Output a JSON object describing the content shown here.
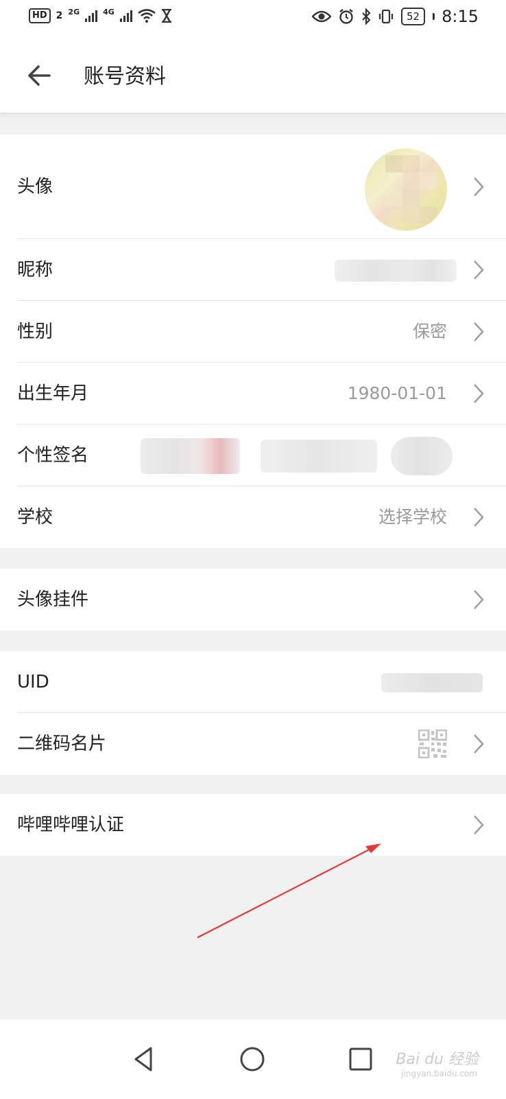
{
  "status_bar": {
    "hd_label": "HD",
    "sim_number": "2",
    "network_1": "2G",
    "network_2": "4G",
    "battery": "52",
    "time": "8:15"
  },
  "header": {
    "title": "账号资料"
  },
  "profile": {
    "avatar_label": "头像",
    "nickname_label": "昵称",
    "gender_label": "性别",
    "gender_value": "保密",
    "birth_label": "出生年月",
    "birth_value": "1980-01-01",
    "signature_label": "个性签名",
    "school_label": "学校",
    "school_value": "选择学校"
  },
  "decoration": {
    "pendant_label": "头像挂件"
  },
  "identity": {
    "uid_label": "UID",
    "qrcode_label": "二维码名片"
  },
  "certification": {
    "label": "哔哩哔哩认证"
  },
  "watermark": {
    "text": "Bai du 经验",
    "sub": "jingyan.baidu.com"
  },
  "colors": {
    "background": "#f1f1f1",
    "surface": "#ffffff",
    "text_primary": "#212121",
    "text_secondary": "#9a9a9a",
    "chevron": "#a0a0a0",
    "annotation_arrow": "#e53935"
  },
  "icons": {
    "back": "arrow-left-icon",
    "chevron": "chevron-right-icon",
    "qr": "qr-code-icon",
    "nav_back": "triangle-back-icon",
    "nav_home": "circle-home-icon",
    "nav_recent": "square-recent-icon"
  }
}
